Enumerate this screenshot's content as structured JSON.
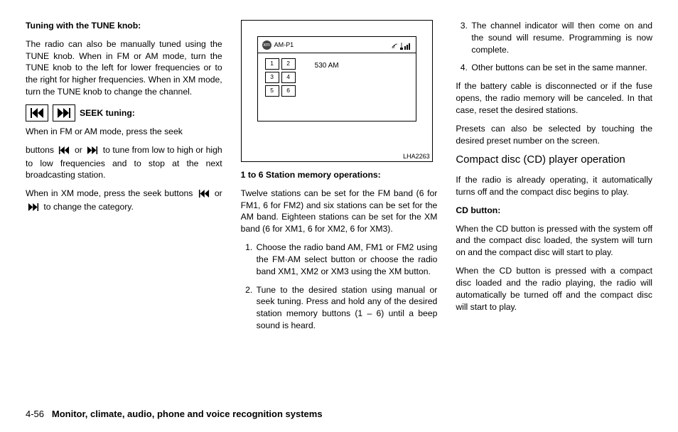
{
  "col1": {
    "h1": "Tuning with the TUNE knob:",
    "p1": "The radio can also be manually tuned using the TUNE knob. When in FM or AM mode, turn the TUNE knob to the left for lower frequencies or to the right for higher frequencies. When in XM mode, turn the TUNE knob to change the channel.",
    "h2": "SEEK tuning:",
    "p2a": "When in FM or AM mode, press the seek",
    "p2b_1": "buttons",
    "p2b_2": "or",
    "p2b_3": "to tune from low to high or high to low frequencies and to stop at the next broadcasting station.",
    "p3_1": "When in XM mode, press the seek buttons",
    "p3_2": "or",
    "p3_3": "to change the category."
  },
  "col2": {
    "screen": {
      "band": "AM-P1",
      "freq": "530 AM",
      "presets": [
        "1",
        "2",
        "3",
        "4",
        "5",
        "6"
      ]
    },
    "fig_id": "LHA2263",
    "h1": "1 to 6 Station memory operations:",
    "p1": "Twelve stations can be set for the FM band (6 for FM1, 6 for FM2) and six stations can be set for the AM band. Eighteen stations can be set for the XM band (6 for XM1, 6 for XM2, 6 for XM3).",
    "li1": "Choose the radio band AM, FM1 or FM2 using the FM·AM select button or choose the radio band XM1, XM2 or XM3 using the XM button.",
    "li2": "Tune to the desired station using manual or seek tuning. Press and hold any of the desired station memory buttons (1 – 6) until a beep sound is heard."
  },
  "col3": {
    "li3": "The channel indicator will then come on and the sound will resume. Programming is now complete.",
    "li4": "Other buttons can be set in the same manner.",
    "p1": "If the battery cable is disconnected or if the fuse opens, the radio memory will be canceled. In that case, reset the desired stations.",
    "p2": "Presets can also be selected by touching the desired preset number on the screen.",
    "h1": "Compact disc (CD) player operation",
    "p3": "If the radio is already operating, it automatically turns off and the compact disc begins to play.",
    "h2": "CD button:",
    "p4": "When the CD button is pressed with the system off and the compact disc loaded, the system will turn on and the compact disc will start to play.",
    "p5": "When the CD button is pressed with a compact disc loaded and the radio playing, the radio will automatically be turned off and the compact disc will start to play."
  },
  "footer": {
    "page": "4-56",
    "title": "Monitor, climate, audio, phone and voice recognition systems"
  }
}
